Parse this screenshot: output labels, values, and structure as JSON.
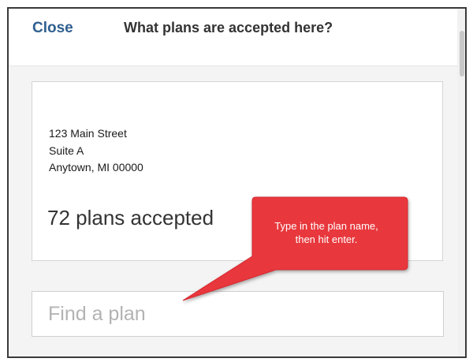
{
  "header": {
    "close_label": "Close",
    "title": "What plans are accepted here?"
  },
  "location": {
    "address_lines": [
      "123 Main Street",
      "Suite A",
      "Anytown, MI 00000"
    ],
    "plans_accepted": "72 plans accepted"
  },
  "search": {
    "placeholder": "Find a plan",
    "value": ""
  },
  "callout": {
    "line1": "Type in the plan name,",
    "line2": "then hit enter.",
    "color": "#e8383d"
  },
  "colors": {
    "link": "#2f5f8f",
    "frame_border": "#3a3a3a",
    "page_background": "#f4f4f4"
  }
}
